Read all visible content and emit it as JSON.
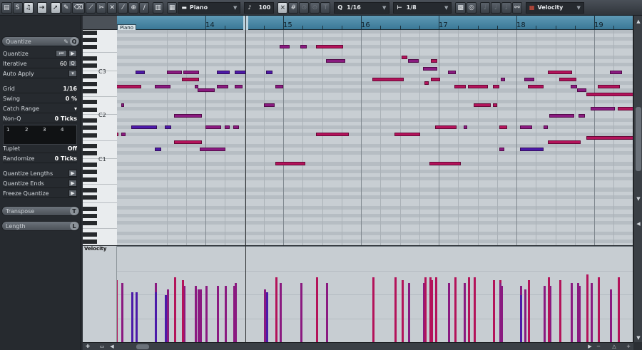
{
  "toolbar": {
    "track_name": "Piano",
    "velocity_value": "100",
    "quantize_value": "1/16",
    "length_value": "1/8",
    "controller_lane": "Velocity",
    "icons": [
      "grid-icon",
      "solo-icon",
      "acoustic-feedback-icon",
      "autoscroll-icon",
      "arrow-icon",
      "pencil-icon",
      "eraser-icon",
      "trim-icon",
      "split-icon",
      "mute-icon",
      "glue-icon",
      "zoom-icon",
      "line-icon",
      "step-input-icon",
      "snap-icon",
      "hash-icon"
    ]
  },
  "inspector": {
    "quantize": {
      "title": "Quantize",
      "q_letter": "Q",
      "quantize_label": "Quantize",
      "iterative_label": "Iterative",
      "iterative_value": "60",
      "auto_apply_label": "Auto Apply",
      "grid_label": "Grid",
      "grid_value": "1/16",
      "swing_label": "Swing",
      "swing_value": "0 %",
      "catch_range_label": "Catch Range",
      "non_q_label": "Non-Q",
      "non_q_value": "0 Ticks",
      "grid_numbers": [
        "1",
        "2",
        "3",
        "4"
      ],
      "tuplet_label": "Tuplet",
      "tuplet_value": "Off",
      "randomize_label": "Randomize",
      "randomize_value": "0 Ticks",
      "quantize_lengths_label": "Quantize Lengths",
      "quantize_ends_label": "Quantize Ends",
      "freeze_quantize_label": "Freeze Quantize"
    },
    "transpose": {
      "title": "Transpose",
      "letter": "T"
    },
    "length": {
      "title": "Length",
      "letter": "L"
    }
  },
  "ruler": {
    "track_tag": "Piano",
    "bars": [
      "14",
      "15",
      "16",
      "17",
      "18",
      "19"
    ]
  },
  "keyboard": {
    "labels": [
      "C3",
      "C2",
      "C1"
    ]
  },
  "velocity_lane": {
    "label": "Velocity"
  },
  "colors": {
    "note_high": "#b3135a",
    "note_mid": "#8a1a80",
    "note_low": "#4b1aa8",
    "ruler": "#4a88a6",
    "grid_bg": "#c8ced3"
  },
  "notes": [
    {
      "bar": 14.95,
      "len": 0.13,
      "pitch": 54,
      "v": 100
    },
    {
      "bar": 15.22,
      "len": 0.08,
      "pitch": 54,
      "v": 100
    },
    {
      "bar": 15.42,
      "len": 0.35,
      "pitch": 54,
      "v": 110
    },
    {
      "bar": 16.52,
      "len": 0.08,
      "pitch": 51,
      "v": 105
    },
    {
      "bar": 15.55,
      "len": 0.25,
      "pitch": 50,
      "v": 100
    },
    {
      "bar": 16.61,
      "len": 0.13,
      "pitch": 50,
      "v": 100
    },
    {
      "bar": 16.9,
      "len": 0.08,
      "pitch": 50,
      "v": 105
    },
    {
      "bar": 16.8,
      "len": 0.18,
      "pitch": 48,
      "v": 100
    },
    {
      "bar": 12.05,
      "len": 0.18,
      "pitch": 47,
      "v": 80
    },
    {
      "bar": 12.55,
      "len": 0.22,
      "pitch": 47,
      "v": 80
    },
    {
      "bar": 13.1,
      "len": 0.12,
      "pitch": 47,
      "v": 85
    },
    {
      "bar": 13.5,
      "len": 0.2,
      "pitch": 47,
      "v": 90
    },
    {
      "bar": 13.72,
      "len": 0.2,
      "pitch": 47,
      "v": 95
    },
    {
      "bar": 14.15,
      "len": 0.16,
      "pitch": 47,
      "v": 85
    },
    {
      "bar": 14.38,
      "len": 0.14,
      "pitch": 47,
      "v": 85
    },
    {
      "bar": 14.78,
      "len": 0.08,
      "pitch": 47,
      "v": 85
    },
    {
      "bar": 17.12,
      "len": 0.1,
      "pitch": 47,
      "v": 100
    },
    {
      "bar": 18.4,
      "len": 0.32,
      "pitch": 47,
      "v": 105
    },
    {
      "bar": 19.2,
      "len": 0.16,
      "pitch": 47,
      "v": 90
    },
    {
      "bar": 13.7,
      "len": 0.22,
      "pitch": 45,
      "v": 105
    },
    {
      "bar": 16.15,
      "len": 0.4,
      "pitch": 45,
      "v": 110
    },
    {
      "bar": 16.9,
      "len": 0.12,
      "pitch": 45,
      "v": 105
    },
    {
      "bar": 17.8,
      "len": 0.05,
      "pitch": 45,
      "v": 95
    },
    {
      "bar": 18.1,
      "len": 0.13,
      "pitch": 45,
      "v": 90
    },
    {
      "bar": 18.55,
      "len": 0.22,
      "pitch": 45,
      "v": 105
    },
    {
      "bar": 16.82,
      "len": 0.05,
      "pitch": 44,
      "v": 110
    },
    {
      "bar": 12.35,
      "len": 0.22,
      "pitch": 43,
      "v": 105
    },
    {
      "bar": 12.84,
      "len": 0.33,
      "pitch": 43,
      "v": 105
    },
    {
      "bar": 13.35,
      "len": 0.2,
      "pitch": 43,
      "v": 100
    },
    {
      "bar": 13.86,
      "len": 0.05,
      "pitch": 43,
      "v": 95
    },
    {
      "bar": 14.15,
      "len": 0.14,
      "pitch": 43,
      "v": 95
    },
    {
      "bar": 14.38,
      "len": 0.1,
      "pitch": 43,
      "v": 100
    },
    {
      "bar": 14.9,
      "len": 0.1,
      "pitch": 43,
      "v": 95
    },
    {
      "bar": 17.2,
      "len": 0.15,
      "pitch": 43,
      "v": 110
    },
    {
      "bar": 17.38,
      "len": 0.25,
      "pitch": 43,
      "v": 110
    },
    {
      "bar": 17.7,
      "len": 0.08,
      "pitch": 43,
      "v": 105
    },
    {
      "bar": 18.15,
      "len": 0.2,
      "pitch": 43,
      "v": 105
    },
    {
      "bar": 18.7,
      "len": 0.08,
      "pitch": 43,
      "v": 100
    },
    {
      "bar": 19.05,
      "len": 0.28,
      "pitch": 43,
      "v": 110
    },
    {
      "bar": 13.9,
      "len": 0.22,
      "pitch": 42,
      "v": 90
    },
    {
      "bar": 18.78,
      "len": 0.12,
      "pitch": 42,
      "v": 100
    },
    {
      "bar": 18.9,
      "len": 0.62,
      "pitch": 41,
      "v": 115
    },
    {
      "bar": 12.5,
      "len": 0.33,
      "pitch": 38,
      "v": 70
    },
    {
      "bar": 12.92,
      "len": 0.03,
      "pitch": 38,
      "v": 90
    },
    {
      "bar": 14.75,
      "len": 0.14,
      "pitch": 38,
      "v": 90
    },
    {
      "bar": 17.45,
      "len": 0.22,
      "pitch": 38,
      "v": 110
    },
    {
      "bar": 17.7,
      "len": 0.05,
      "pitch": 38,
      "v": 105
    },
    {
      "bar": 18.95,
      "len": 0.32,
      "pitch": 37,
      "v": 100
    },
    {
      "bar": 19.3,
      "len": 0.26,
      "pitch": 37,
      "v": 110
    },
    {
      "bar": 13.6,
      "len": 0.35,
      "pitch": 35,
      "v": 90
    },
    {
      "bar": 18.42,
      "len": 0.32,
      "pitch": 35,
      "v": 95
    },
    {
      "bar": 18.8,
      "len": 0.08,
      "pitch": 35,
      "v": 95
    },
    {
      "bar": 12.15,
      "len": 0.18,
      "pitch": 32,
      "v": 85
    },
    {
      "bar": 13.05,
      "len": 0.33,
      "pitch": 32,
      "v": 85
    },
    {
      "bar": 13.48,
      "len": 0.08,
      "pitch": 32,
      "v": 80
    },
    {
      "bar": 14.0,
      "len": 0.2,
      "pitch": 32,
      "v": 95
    },
    {
      "bar": 14.25,
      "len": 0.06,
      "pitch": 32,
      "v": 95
    },
    {
      "bar": 14.36,
      "len": 0.07,
      "pitch": 32,
      "v": 95
    },
    {
      "bar": 16.95,
      "len": 0.28,
      "pitch": 32,
      "v": 110
    },
    {
      "bar": 17.32,
      "len": 0.05,
      "pitch": 32,
      "v": 100
    },
    {
      "bar": 17.78,
      "len": 0.1,
      "pitch": 32,
      "v": 105
    },
    {
      "bar": 18.05,
      "len": 0.15,
      "pitch": 32,
      "v": 95
    },
    {
      "bar": 18.35,
      "len": 0.05,
      "pitch": 32,
      "v": 95
    },
    {
      "bar": 12.55,
      "len": 0.33,
      "pitch": 30,
      "v": 105
    },
    {
      "bar": 12.92,
      "len": 0.05,
      "pitch": 30,
      "v": 100
    },
    {
      "bar": 15.42,
      "len": 0.42,
      "pitch": 30,
      "v": 110
    },
    {
      "bar": 16.43,
      "len": 0.33,
      "pitch": 30,
      "v": 110
    },
    {
      "bar": 18.9,
      "len": 0.62,
      "pitch": 29,
      "v": 115
    },
    {
      "bar": 13.6,
      "len": 0.35,
      "pitch": 28,
      "v": 110
    },
    {
      "bar": 18.4,
      "len": 0.43,
      "pitch": 28,
      "v": 110
    },
    {
      "bar": 13.93,
      "len": 0.33,
      "pitch": 26,
      "v": 90
    },
    {
      "bar": 13.35,
      "len": 0.08,
      "pitch": 26,
      "v": 85
    },
    {
      "bar": 17.78,
      "len": 0.06,
      "pitch": 26,
      "v": 100
    },
    {
      "bar": 18.05,
      "len": 0.3,
      "pitch": 26,
      "v": 80
    },
    {
      "bar": 12.05,
      "len": 0.3,
      "pitch": 22,
      "v": 110
    },
    {
      "bar": 14.9,
      "len": 0.38,
      "pitch": 22,
      "v": 110
    },
    {
      "bar": 16.88,
      "len": 0.4,
      "pitch": 22,
      "v": 110
    }
  ]
}
